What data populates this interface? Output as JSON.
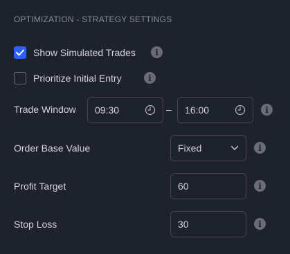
{
  "section_title": "OPTIMIZATION - STRATEGY SETTINGS",
  "show_simulated_trades": {
    "label": "Show Simulated Trades",
    "checked": true
  },
  "prioritize_initial_entry": {
    "label": "Prioritize Initial Entry",
    "checked": false
  },
  "trade_window": {
    "label": "Trade Window",
    "start": "09:30",
    "end": "16:00",
    "separator": "–"
  },
  "order_base_value": {
    "label": "Order Base Value",
    "selected": "Fixed"
  },
  "profit_target": {
    "label": "Profit Target",
    "value": "60"
  },
  "stop_loss": {
    "label": "Stop Loss",
    "value": "30"
  },
  "info_glyph": "i",
  "colors": {
    "accent": "#2962ff",
    "background": "#1e222d",
    "border": "#434651",
    "muted": "#6a6d78"
  }
}
